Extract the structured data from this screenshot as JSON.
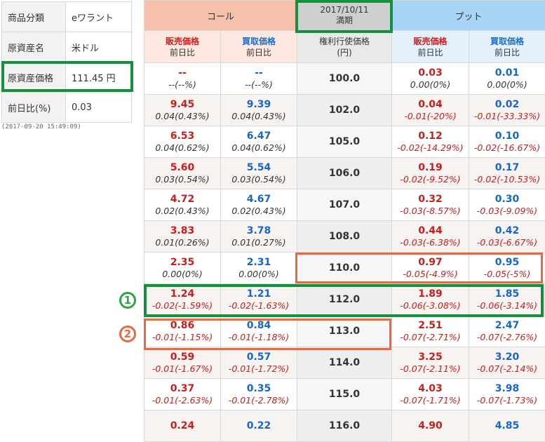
{
  "info": {
    "rows": [
      {
        "key": "商品分類",
        "value": "eワラント"
      },
      {
        "key": "原資産名",
        "value": "米ドル"
      },
      {
        "key": "原資産価格",
        "value": "111.45 円"
      },
      {
        "key": "前日比(%)",
        "value": "0.03"
      }
    ],
    "timestamp": "(2017-09-20 15:49:09)"
  },
  "header": {
    "call": "コール",
    "date": "2017/10/11",
    "maturity": "満期",
    "put": "プット",
    "sell_price": "販売価格",
    "buy_price": "買取価格",
    "prev_day": "前日比",
    "strike_line1": "権利行使価格",
    "strike_line2": "(円)"
  },
  "rows": [
    {
      "call_sell": "--",
      "call_sell_chg": "--(--%)",
      "call_buy": "--",
      "call_buy_chg": "--(--%)",
      "strike": "100.0",
      "put_sell": "0.03",
      "put_sell_chg": "0.00(0%)",
      "put_buy": "0.01",
      "put_buy_chg": "0.00(0%)"
    },
    {
      "call_sell": "9.45",
      "call_sell_chg": "0.04(0.43%)",
      "call_buy": "9.39",
      "call_buy_chg": "0.04(0.43%)",
      "strike": "102.0",
      "put_sell": "0.04",
      "put_sell_chg": "-0.01(-20%)",
      "put_buy": "0.02",
      "put_buy_chg": "-0.01(-33.33%)"
    },
    {
      "call_sell": "6.53",
      "call_sell_chg": "0.04(0.62%)",
      "call_buy": "6.47",
      "call_buy_chg": "0.04(0.62%)",
      "strike": "105.0",
      "put_sell": "0.12",
      "put_sell_chg": "-0.02(-14.29%)",
      "put_buy": "0.10",
      "put_buy_chg": "-0.02(-16.67%)"
    },
    {
      "call_sell": "5.60",
      "call_sell_chg": "0.03(0.54%)",
      "call_buy": "5.54",
      "call_buy_chg": "0.03(0.54%)",
      "strike": "106.0",
      "put_sell": "0.19",
      "put_sell_chg": "-0.02(-9.52%)",
      "put_buy": "0.17",
      "put_buy_chg": "-0.02(-10.53%)"
    },
    {
      "call_sell": "4.72",
      "call_sell_chg": "0.02(0.43%)",
      "call_buy": "4.67",
      "call_buy_chg": "0.02(0.43%)",
      "strike": "107.0",
      "put_sell": "0.32",
      "put_sell_chg": "-0.03(-8.57%)",
      "put_buy": "0.30",
      "put_buy_chg": "-0.03(-9.09%)"
    },
    {
      "call_sell": "3.83",
      "call_sell_chg": "0.01(0.26%)",
      "call_buy": "3.78",
      "call_buy_chg": "0.01(0.27%)",
      "strike": "108.0",
      "put_sell": "0.44",
      "put_sell_chg": "-0.03(-6.38%)",
      "put_buy": "0.42",
      "put_buy_chg": "-0.03(-6.67%)"
    },
    {
      "call_sell": "2.35",
      "call_sell_chg": "0.00(0%)",
      "call_buy": "2.31",
      "call_buy_chg": "0.00(0%)",
      "strike": "110.0",
      "put_sell": "0.97",
      "put_sell_chg": "-0.05(-4.9%)",
      "put_buy": "0.95",
      "put_buy_chg": "-0.05(-5%)"
    },
    {
      "call_sell": "1.24",
      "call_sell_chg": "-0.02(-1.59%)",
      "call_buy": "1.21",
      "call_buy_chg": "-0.02(-1.63%)",
      "strike": "112.0",
      "put_sell": "1.89",
      "put_sell_chg": "-0.06(-3.08%)",
      "put_buy": "1.85",
      "put_buy_chg": "-0.06(-3.14%)"
    },
    {
      "call_sell": "0.86",
      "call_sell_chg": "-0.01(-1.15%)",
      "call_buy": "0.84",
      "call_buy_chg": "-0.01(-1.18%)",
      "strike": "113.0",
      "put_sell": "2.51",
      "put_sell_chg": "-0.07(-2.71%)",
      "put_buy": "2.47",
      "put_buy_chg": "-0.07(-2.76%)"
    },
    {
      "call_sell": "0.59",
      "call_sell_chg": "-0.01(-1.67%)",
      "call_buy": "0.57",
      "call_buy_chg": "-0.01(-1.72%)",
      "strike": "114.0",
      "put_sell": "3.25",
      "put_sell_chg": "-0.07(-2.11%)",
      "put_buy": "3.20",
      "put_buy_chg": "-0.07(-2.14%)"
    },
    {
      "call_sell": "0.37",
      "call_sell_chg": "-0.01(-2.63%)",
      "call_buy": "0.35",
      "call_buy_chg": "-0.01(-2.78%)",
      "strike": "115.0",
      "put_sell": "4.03",
      "put_sell_chg": "-0.07(-1.71%)",
      "put_buy": "3.98",
      "put_buy_chg": "-0.07(-1.73%)"
    },
    {
      "call_sell": "0.24",
      "call_sell_chg": "",
      "call_buy": "0.22",
      "call_buy_chg": "",
      "strike": "116.0",
      "put_sell": "4.90",
      "put_sell_chg": "",
      "put_buy": "4.85",
      "put_buy_chg": ""
    }
  ],
  "annotations": {
    "marker1": "1",
    "marker2": "2"
  },
  "colors": {
    "call_header": "#f5c1ad",
    "put_header": "#a8d4f5",
    "date_header": "#cfcfcf",
    "sell_text": "#cc1d1d",
    "buy_text": "#1766c9",
    "highlight_green": "#13913c",
    "highlight_orange": "#e8693c"
  }
}
